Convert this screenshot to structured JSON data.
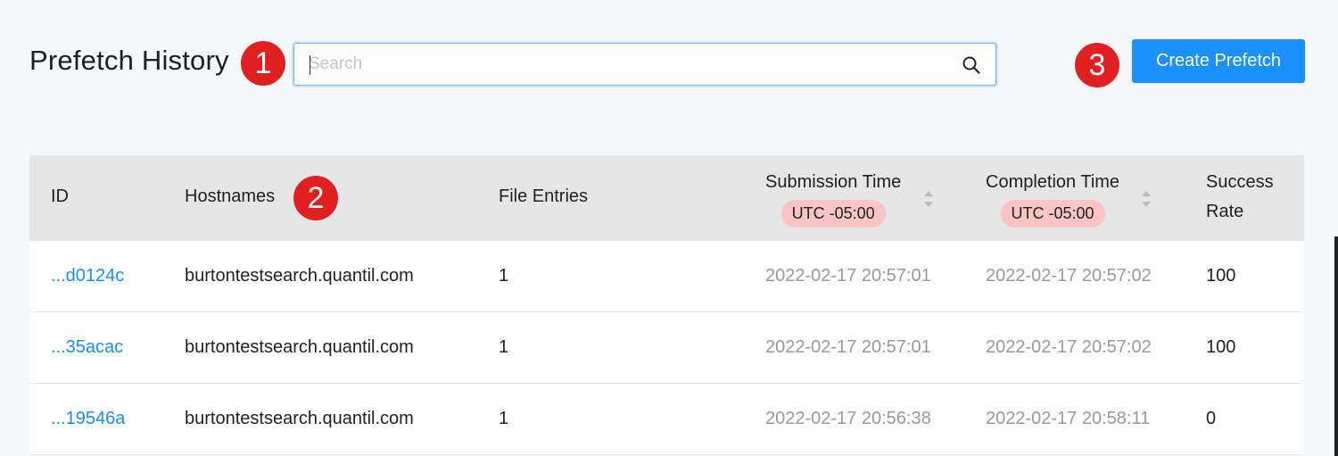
{
  "header": {
    "title": "Prefetch History",
    "search_placeholder": "Search",
    "create_label": "Create Prefetch"
  },
  "markers": [
    "1",
    "2",
    "3"
  ],
  "table": {
    "columns": {
      "id": "ID",
      "hostnames": "Hostnames",
      "file_entries": "File Entries",
      "submission_time": "Submission Time",
      "completion_time": "Completion Time",
      "success_rate_line1": "Success",
      "success_rate_line2": "Rate",
      "timezone": "UTC -05:00"
    },
    "rows": [
      {
        "id": "...d0124c",
        "hostnames": "burtontestsearch.quantil.com",
        "file_entries": "1",
        "submission_time": "2022-02-17 20:57:01",
        "completion_time": "2022-02-17 20:57:02",
        "success_rate": "100"
      },
      {
        "id": "...35acac",
        "hostnames": "burtontestsearch.quantil.com",
        "file_entries": "1",
        "submission_time": "2022-02-17 20:57:01",
        "completion_time": "2022-02-17 20:57:02",
        "success_rate": "100"
      },
      {
        "id": "...19546a",
        "hostnames": "burtontestsearch.quantil.com",
        "file_entries": "1",
        "submission_time": "2022-02-17 20:56:38",
        "completion_time": "2022-02-17 20:58:11",
        "success_rate": "0"
      }
    ]
  },
  "colors": {
    "accent": "#1b90ff",
    "marker": "#e02020",
    "timezone_badge": "#f9c4c4",
    "header_bg": "#e6e6e6"
  },
  "icons": [
    "search-icon",
    "sort-icon"
  ]
}
